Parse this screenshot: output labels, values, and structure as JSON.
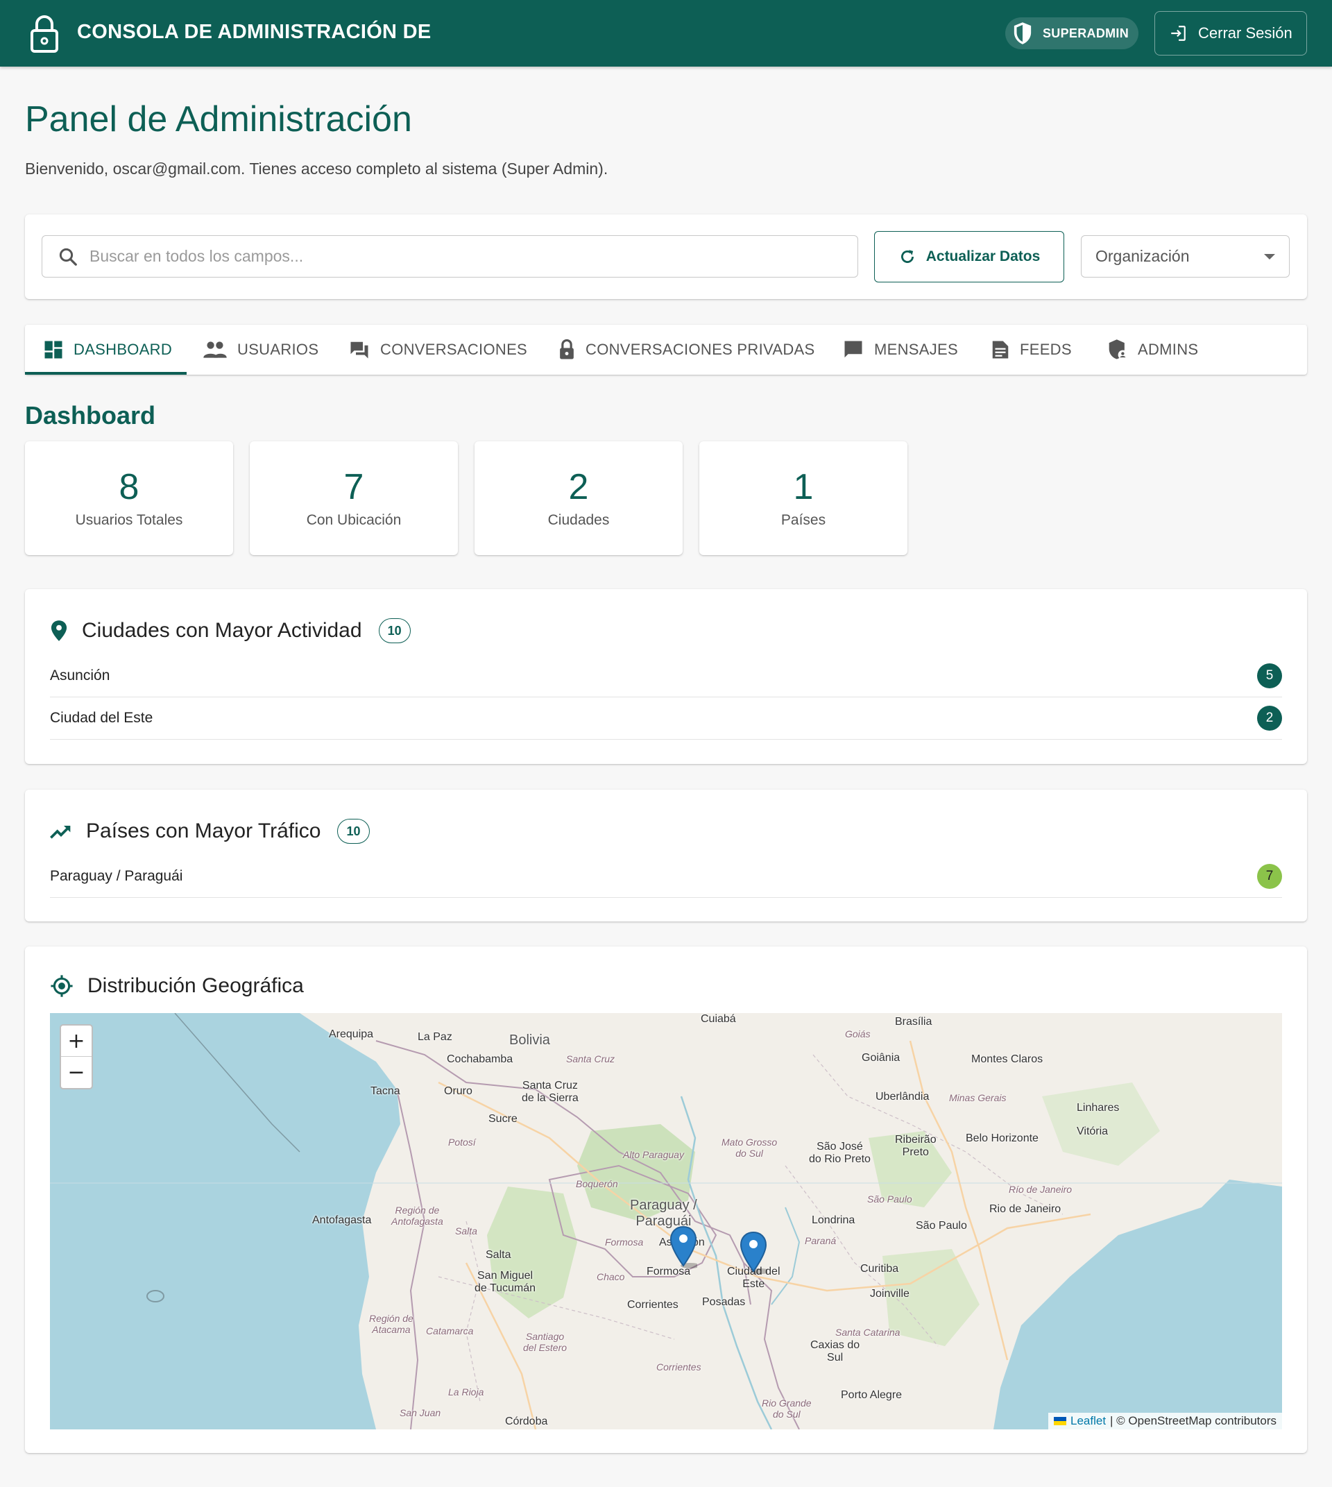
{
  "header": {
    "title": "CONSOLA DE ADMINISTRACIÓN DE",
    "role": "SUPERADMIN",
    "logout_label": "Cerrar Sesión"
  },
  "page": {
    "title": "Panel de Administración",
    "welcome": "Bienvenido, oscar@gmail.com. Tienes acceso completo al sistema (Super Admin)."
  },
  "toolbar": {
    "search_placeholder": "Buscar en todos los campos...",
    "search_value": "",
    "refresh_label": "Actualizar Datos",
    "org_select_value": "Organización"
  },
  "tabs": [
    {
      "label": "DASHBOARD",
      "icon": "dashboard-icon",
      "active": true
    },
    {
      "label": "USUARIOS",
      "icon": "people-icon"
    },
    {
      "label": "CONVERSACIONES",
      "icon": "forum-icon"
    },
    {
      "label": "CONVERSACIONES PRIVADAS",
      "icon": "lock-icon"
    },
    {
      "label": "MENSAJES",
      "icon": "chat-bubble-icon"
    },
    {
      "label": "FEEDS",
      "icon": "article-icon"
    },
    {
      "label": "ADMINS",
      "icon": "admin-shield-icon"
    }
  ],
  "dashboard": {
    "title": "Dashboard",
    "stats": [
      {
        "value": "8",
        "label": "Usuarios Totales"
      },
      {
        "value": "7",
        "label": "Con Ubicación"
      },
      {
        "value": "2",
        "label": "Ciudades"
      },
      {
        "value": "1",
        "label": "Países"
      }
    ],
    "cities": {
      "title": "Ciudades con Mayor Actividad",
      "count": "10",
      "items": [
        {
          "name": "Asunción",
          "value": "5"
        },
        {
          "name": "Ciudad del Este",
          "value": "2"
        }
      ]
    },
    "countries": {
      "title": "Países con Mayor Tráfico",
      "count": "10",
      "items": [
        {
          "name": "Paraguay / Paraguái",
          "value": "7"
        }
      ]
    },
    "map": {
      "title": "Distribución Geográfica",
      "zoom_in": "+",
      "zoom_out": "−",
      "attribution_leaflet": "Leaflet",
      "attribution_rest": "| © OpenStreetMap contributors",
      "labels": {
        "cuiaba": "Cuiabá",
        "brasilia": "Brasília",
        "goias": "Goiás",
        "arequipa": "Arequipa",
        "lapaz": "La Paz",
        "bolivia": "Bolivia",
        "cochabamba": "Cochabamba",
        "santacruz_reg": "Santa Cruz",
        "goiania": "Goiânia",
        "montesclaros": "Montes Claros",
        "santacruz": "Santa Cruz\nde la Sierra",
        "tacna": "Tacna",
        "oruro": "Oruro",
        "sucre": "Sucre",
        "uberlandia": "Uberlândia",
        "minasgerais": "Minas Gerais",
        "linhares": "Linhares",
        "vitoria": "Vitória",
        "potosi": "Potosí",
        "matogrosso": "Mato Grosso\ndo Sul",
        "saojose": "São José\ndo Rio Preto",
        "ribeirao": "Ribeirão\nPreto",
        "belohorizonte": "Belo Horizonte",
        "altoparaguay": "Alto Paraguay",
        "boqueron": "Boquerón",
        "riojaneiro_reg": "Río de Janeiro",
        "saopaulo_reg": "São Paulo",
        "paraguay": "Paraguay /\nParaguái",
        "riojaneiro": "Rio de Janeiro",
        "antofagasta": "Antofagasta",
        "antofagasta_reg": "Región de\nAntofagasta",
        "salta_reg": "Salta",
        "londrina": "Londrina",
        "saopaulo": "São Paulo",
        "formosa_reg": "Formosa",
        "asuncion": "Asunción",
        "parana": "Paraná",
        "salta": "Salta",
        "sanmiguel": "San Miguel\nde Tucumán",
        "chaco": "Chaco",
        "formosa": "Formosa",
        "ciudaddeleste": "Ciudad del\nEste",
        "curitiba": "Curitiba",
        "joinville": "Joinville",
        "corrientes": "Corrientes",
        "posadas": "Posadas",
        "atacama": "Región de\nAtacama",
        "catamarca": "Catamarca",
        "santiago": "Santiago\ndel Estero",
        "santacatarina": "Santa Catarina",
        "caxias": "Caxias do\nSul",
        "corrientes_reg": "Corrientes",
        "larioja": "La Rioja",
        "portoalegre": "Porto Alegre",
        "riogrande": "Rio Grande\ndo Sul",
        "sanjuan": "San Juan",
        "cordoba": "Córdoba"
      }
    }
  },
  "colors": {
    "primary": "#0d5f55",
    "badge_green": "#8bc34a",
    "map_water": "#aad3df",
    "map_land": "#f2efe9",
    "marker": "#2a81cb"
  }
}
